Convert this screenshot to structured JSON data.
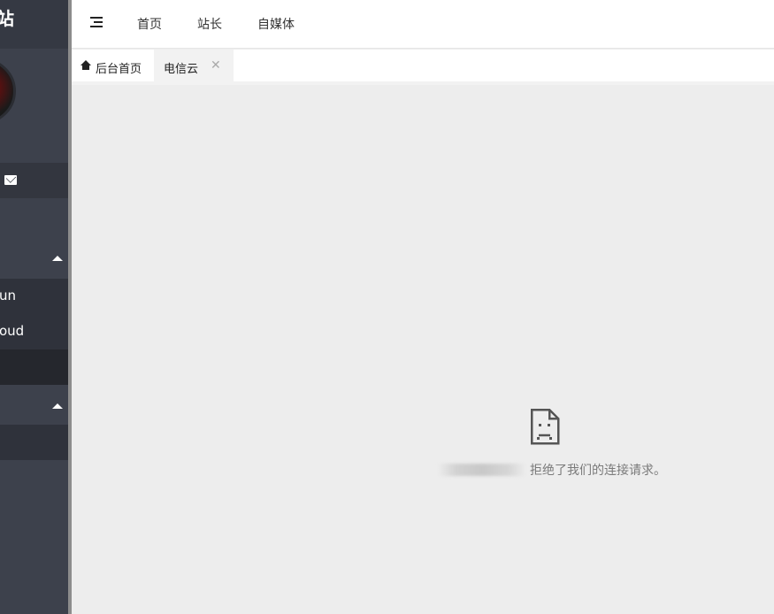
{
  "sidebar": {
    "logo_text": "站",
    "menu": {
      "sub_items": [
        {
          "label": "un"
        },
        {
          "label": "oud"
        },
        {
          "label": ""
        }
      ]
    }
  },
  "topbar": {
    "nav": [
      {
        "label": "首页"
      },
      {
        "label": "站长"
      },
      {
        "label": "自媒体"
      }
    ]
  },
  "tabs": [
    {
      "label": "后台首页",
      "icon": "home-icon"
    },
    {
      "label": "电信云",
      "close": "✕"
    }
  ],
  "content": {
    "error_message": "拒绝了我们的连接请求。"
  }
}
